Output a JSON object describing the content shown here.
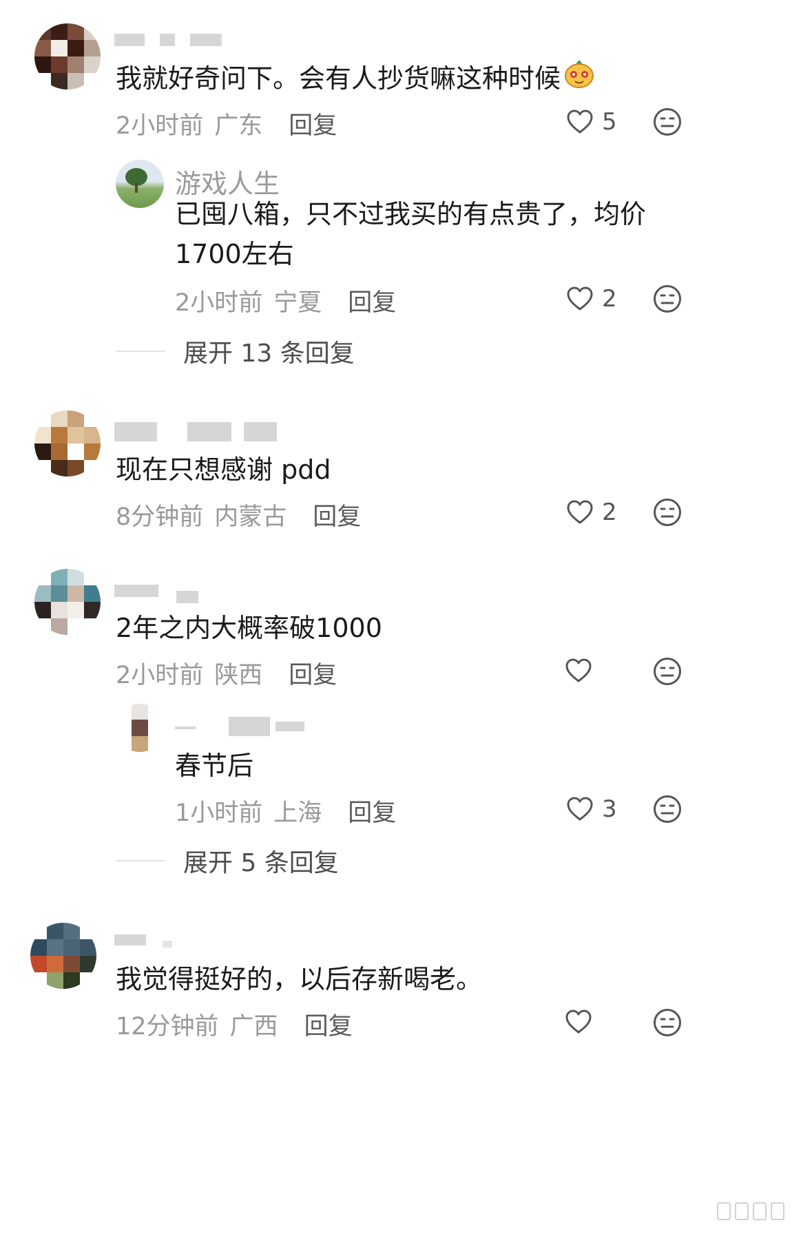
{
  "comments": [
    {
      "text": "我就好奇问下。会有人抄货嘛这种时候",
      "emoji": "orange-face-emoji",
      "time": "2小时前",
      "location": "广东",
      "reply_label": "回复",
      "likes": "5",
      "replies": [
        {
          "name": "游戏人生",
          "text_lines": [
            "已囤八箱，只不过我买的有点贵了，均价",
            "1700左右"
          ],
          "time": "2小时前",
          "location": "宁夏",
          "reply_label": "回复",
          "likes": "2"
        }
      ],
      "expand_label": "展开 13 条回复"
    },
    {
      "text": "现在只想感谢 pdd",
      "time": "8分钟前",
      "location": "内蒙古",
      "reply_label": "回复",
      "likes": "2"
    },
    {
      "text": "2年之内大概率破1000",
      "time": "2小时前",
      "location": "陕西",
      "reply_label": "回复",
      "likes": "",
      "replies": [
        {
          "text_lines": [
            "春节后"
          ],
          "time": "1小时前",
          "location": "上海",
          "reply_label": "回复",
          "likes": "3"
        }
      ],
      "expand_label": "展开 5 条回复"
    },
    {
      "text": "我觉得挺好的，以后存新喝老。",
      "time": "12分钟前",
      "location": "广西",
      "reply_label": "回复",
      "likes": ""
    }
  ],
  "icons": {
    "like": "heart-outline-icon",
    "dislike": "neutral-face-icon"
  },
  "colors": {
    "text": "#1a1a1a",
    "meta": "#999999",
    "icon": "#555555"
  }
}
